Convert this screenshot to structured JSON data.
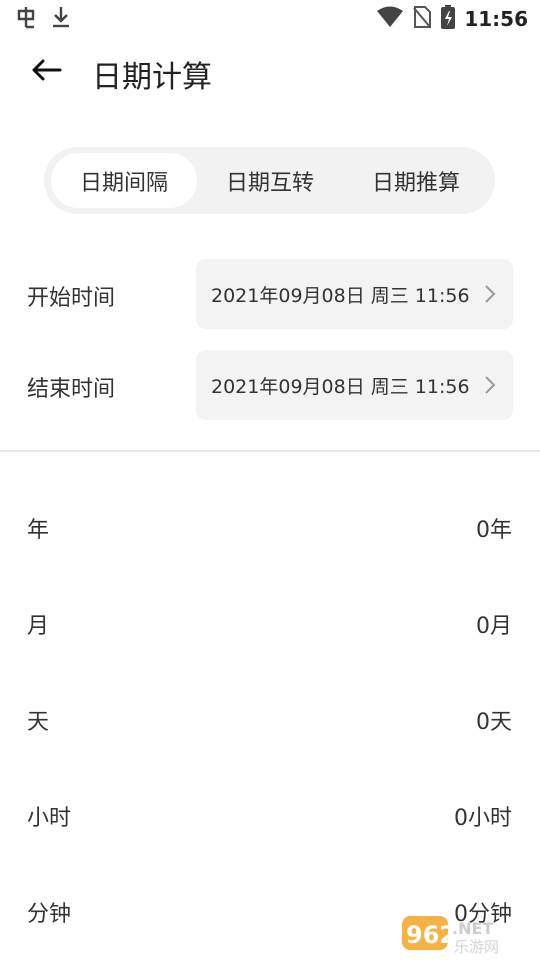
{
  "status_bar": {
    "left_icons": [
      "bug-icon",
      "download-icon"
    ],
    "right_icons": [
      "wifi-icon",
      "no-sim-icon",
      "battery-charging-icon"
    ],
    "time": "11:56"
  },
  "app_bar": {
    "back_icon": "arrow-left-icon",
    "title": "日期计算"
  },
  "tabs": [
    {
      "label": "日期间隔",
      "active": true
    },
    {
      "label": "日期互转",
      "active": false
    },
    {
      "label": "日期推算",
      "active": false
    }
  ],
  "start": {
    "label": "开始时间",
    "value": "2021年09月08日 周三 11:56"
  },
  "end": {
    "label": "结束时间",
    "value": "2021年09月08日 周三 11:56"
  },
  "results": [
    {
      "label": "年",
      "value": "0年"
    },
    {
      "label": "月",
      "value": "0月"
    },
    {
      "label": "天",
      "value": "0天"
    },
    {
      "label": "小时",
      "value": "0小时"
    },
    {
      "label": "分钟",
      "value": "0分钟"
    }
  ],
  "watermark": {
    "brand": "962.NET",
    "sub": "乐游网"
  }
}
